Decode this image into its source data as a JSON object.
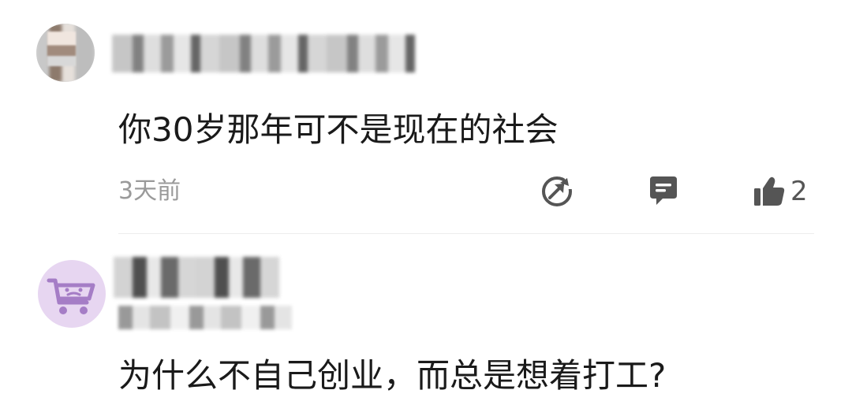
{
  "comments": [
    {
      "author_name": "",
      "text": "你30岁那年可不是现在的社会",
      "timestamp": "3天前",
      "actions": {
        "share_icon": "share-icon",
        "reply_icon": "reply-icon",
        "like_icon": "thumbs-up-icon",
        "like_count": "2"
      }
    },
    {
      "author_name": "",
      "author_subtitle": "",
      "avatar_icon": "shopping-cart-icon",
      "text": "为什么不自己创业，而总是想着打工?"
    }
  ],
  "colors": {
    "background": "#ffffff",
    "text": "#1a1a1a",
    "muted": "#9a9a9a",
    "icon": "#555555",
    "avatar_cart_bg": "#e7d6f1",
    "avatar_cart_fg": "#a57dc6"
  }
}
